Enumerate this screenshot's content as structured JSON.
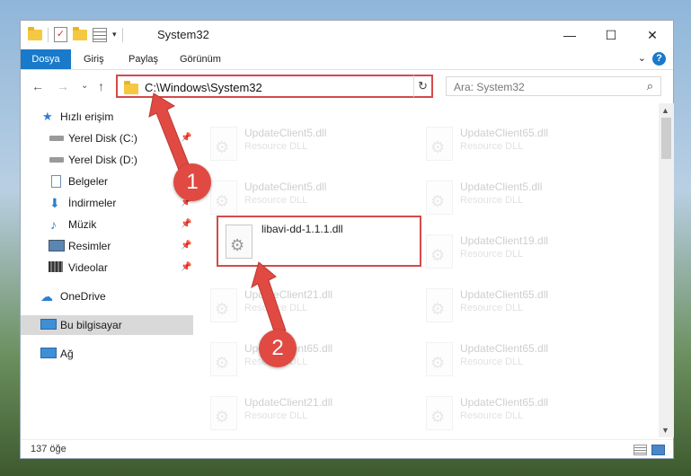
{
  "window": {
    "title": "System32",
    "minimize_icon": "minimize-icon",
    "maximize_icon": "maximize-icon",
    "close_icon": "close-icon"
  },
  "ribbon": {
    "tabs": [
      "Dosya",
      "Giriş",
      "Paylaş",
      "Görünüm"
    ]
  },
  "address": {
    "path": "C:\\Windows\\System32"
  },
  "search": {
    "placeholder": "Ara: System32"
  },
  "sidebar": {
    "items": [
      {
        "label": "Hızlı erişim",
        "icon": "star-icon"
      },
      {
        "label": "Yerel Disk (C:)",
        "icon": "drive-icon"
      },
      {
        "label": "Yerel Disk (D:)",
        "icon": "drive-icon"
      },
      {
        "label": "Belgeler",
        "icon": "document-icon"
      },
      {
        "label": "İndirmeler",
        "icon": "download-icon"
      },
      {
        "label": "Müzik",
        "icon": "music-icon"
      },
      {
        "label": "Resimler",
        "icon": "picture-icon"
      },
      {
        "label": "Videolar",
        "icon": "video-icon"
      },
      {
        "label": "OneDrive",
        "icon": "cloud-icon"
      },
      {
        "label": "Bu bilgisayar",
        "icon": "computer-icon"
      },
      {
        "label": "Ağ",
        "icon": "network-icon"
      }
    ]
  },
  "files": {
    "left": [
      {
        "name": "UpdateClient5.dll",
        "type": "Resource DLL"
      },
      {
        "name": "UpdateClient5.dll",
        "type": "Resource DLL"
      },
      {
        "name": "libavi-dd-1.1.1.dll",
        "type": ""
      },
      {
        "name": "UpdateClient21.dll",
        "type": "Resource DLL"
      },
      {
        "name": "UpdateClient65.dll",
        "type": "Resource DLL"
      },
      {
        "name": "UpdateClient21.dll",
        "type": "Resource DLL"
      }
    ],
    "right": [
      {
        "name": "UpdateClient65.dll",
        "type": "Resource DLL"
      },
      {
        "name": "UpdateClient5.dll",
        "type": "Resource DLL"
      },
      {
        "name": "UpdateClient19.dll",
        "type": "Resource DLL"
      },
      {
        "name": "UpdateClient65.dll",
        "type": "Resource DLL"
      },
      {
        "name": "UpdateClient65.dll",
        "type": "Resource DLL"
      },
      {
        "name": "UpdateClient65.dll",
        "type": "Resource DLL"
      }
    ]
  },
  "status": {
    "count": "137 öğe"
  },
  "annotations": {
    "step1": "1",
    "step2": "2",
    "color": "#d44a4a"
  }
}
